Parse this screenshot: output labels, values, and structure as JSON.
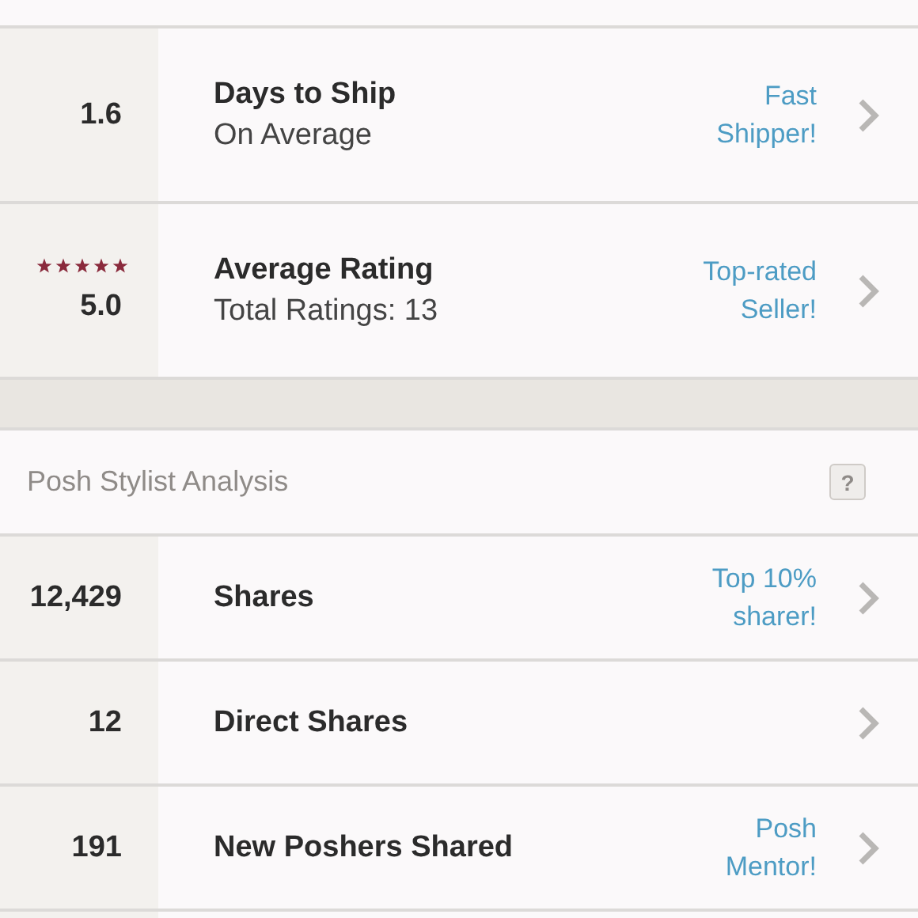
{
  "seller_stats": [
    {
      "value": "1.6",
      "title": "Days to Ship",
      "subtitle": "On Average",
      "badge": "Fast\nShipper!"
    },
    {
      "value": "5.0",
      "stars": 5,
      "title": "Average Rating",
      "subtitle": "Total Ratings: 13",
      "badge": "Top-rated\nSeller!"
    }
  ],
  "analysis": {
    "title": "Posh Stylist Analysis",
    "help": "?",
    "rows": [
      {
        "value": "12,429",
        "title": "Shares",
        "badge": "Top 10%\nsharer!"
      },
      {
        "value": "12",
        "title": "Direct Shares"
      },
      {
        "value": "191",
        "title": "New Poshers Shared",
        "badge": "Posh\nMentor!"
      }
    ]
  }
}
